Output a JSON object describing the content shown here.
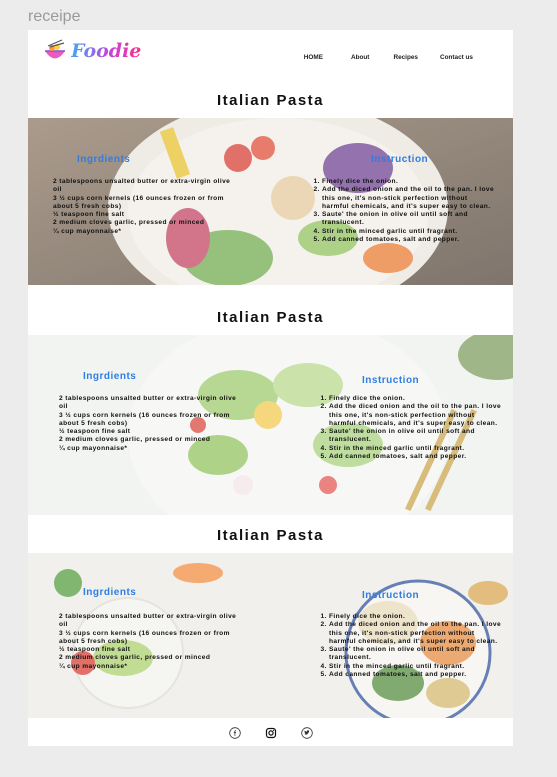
{
  "frame_label": "receipe",
  "header": {
    "logo_text": "Foodie",
    "nav": [
      {
        "label": "HOME"
      },
      {
        "label": "About"
      },
      {
        "label": "Recipes"
      },
      {
        "label": "Contact us"
      }
    ]
  },
  "recipes": [
    {
      "title": "Italian Pasta",
      "ingredients_heading": "Ingrdients",
      "instructions_heading": "Instruction",
      "ingredients": [
        "2 tablespoons unsalted butter or extra-virgin olive oil",
        "3 ½ cups corn kernels (16 ounces frozen or from about 5 fresh cobs)",
        "½ teaspoon fine salt",
        "2 medium cloves garlic, pressed or minced",
        "¼ cup mayonnaise*"
      ],
      "instructions": [
        "Finely dice the onion.",
        "Add the diced onion and the oil to the pan. I love this one, it's non-stick perfection without harmful chemicals, and it's super easy to clean.",
        "Saute' the onion in olive oil until soft and translucent.",
        "Stir in the minced garlic until fragrant.",
        "Add canned tomatoes, salt and pepper."
      ]
    },
    {
      "title": "Italian Pasta",
      "ingredients_heading": "Ingrdients",
      "instructions_heading": "Instruction",
      "ingredients": [
        "2 tablespoons unsalted butter or extra-virgin olive oil",
        "3 ½ cups corn kernels (16 ounces frozen or from about 5 fresh cobs)",
        "½ teaspoon fine salt",
        "2 medium cloves garlic, pressed or minced",
        "¼ cup mayonnaise*"
      ],
      "instructions": [
        "Finely dice the onion.",
        "Add the diced onion and the oil to the pan. I love this one, it's non-stick perfection without harmful chemicals, and it's super easy to clean.",
        "Saute' the onion in olive oil until soft and translucent.",
        "Stir in the minced garlic until fragrant.",
        "Add canned tomatoes, salt and pepper."
      ]
    },
    {
      "title": "Italian Pasta",
      "ingredients_heading": "Ingrdients",
      "instructions_heading": "Instruction",
      "ingredients": [
        "2 tablespoons unsalted butter or extra-virgin olive oil",
        "3 ½ cups corn kernels (16 ounces frozen or from about 5 fresh cobs)",
        "½ teaspoon fine salt",
        "2 medium cloves garlic, pressed or minced",
        "¼ cup mayonnaise*"
      ],
      "instructions": [
        "Finely dice the onion.",
        "Add the diced onion and the oil to the pan. I love this one, it's non-stick perfection without harmful chemicals, and it's super easy to clean.",
        "Saute' the onion in olive oil until soft and translucent.",
        "Stir in the minced garlic until fragrant.",
        "Add canned tomatoes, salt and pepper."
      ]
    }
  ],
  "footer": {
    "icons": [
      "facebook-icon",
      "instagram-icon",
      "twitter-icon"
    ]
  },
  "colors": {
    "heading_blue": "#2f7de1",
    "logo_gradient_start": "#3fa9f5",
    "logo_gradient_end": "#ff2d88"
  }
}
